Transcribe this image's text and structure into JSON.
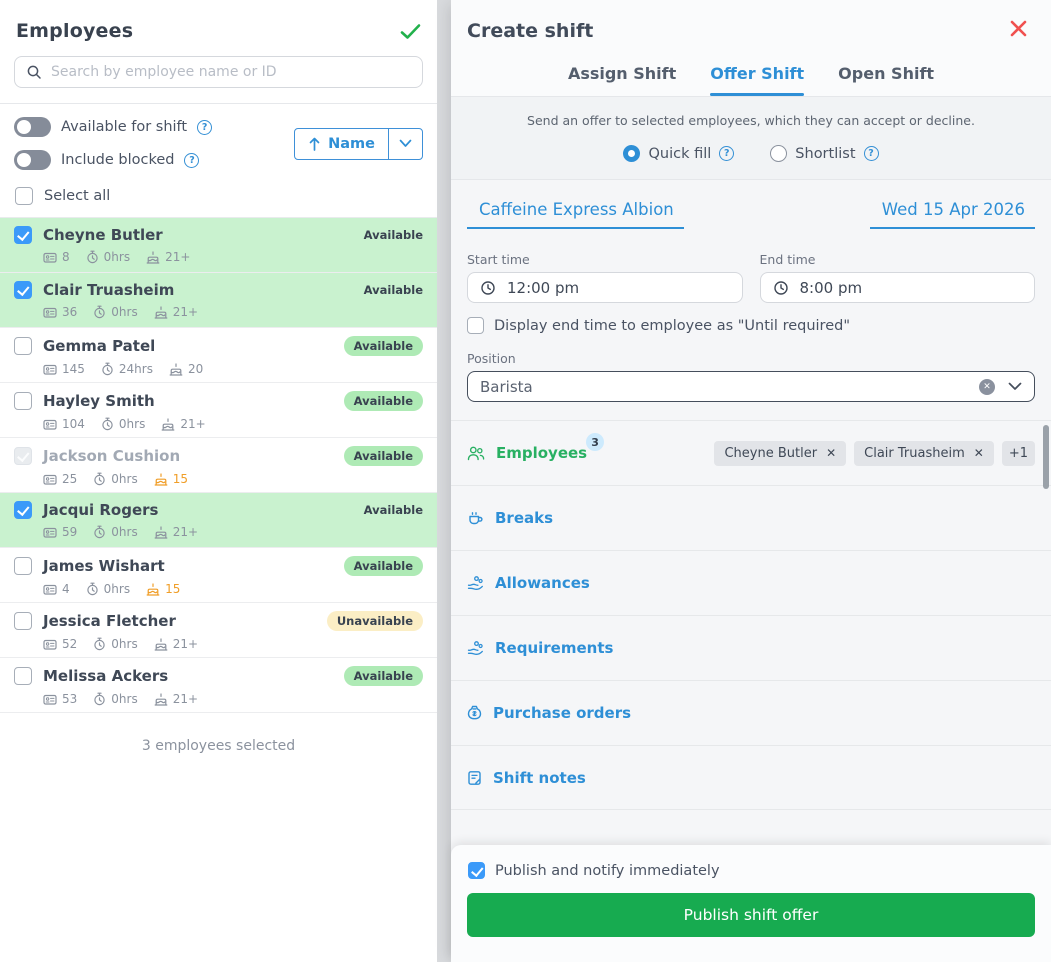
{
  "left_panel": {
    "title": "Employees",
    "search_placeholder": "Search by employee name or ID",
    "filters": {
      "available_for_shift": "Available for shift",
      "include_blocked": "Include blocked"
    },
    "sort": {
      "label": "Name"
    },
    "select_all_label": "Select all",
    "employees": [
      {
        "name": "Cheyne Butler",
        "status": "Available",
        "shifts": "8",
        "hours": "0hrs",
        "age": "21+",
        "selected": true,
        "disabled": false,
        "age_warning": false
      },
      {
        "name": "Clair Truasheim",
        "status": "Available",
        "shifts": "36",
        "hours": "0hrs",
        "age": "21+",
        "selected": true,
        "disabled": false,
        "age_warning": false
      },
      {
        "name": "Gemma Patel",
        "status": "Available",
        "shifts": "145",
        "hours": "24hrs",
        "age": "20",
        "selected": false,
        "disabled": false,
        "age_warning": false
      },
      {
        "name": "Hayley Smith",
        "status": "Available",
        "shifts": "104",
        "hours": "0hrs",
        "age": "21+",
        "selected": false,
        "disabled": false,
        "age_warning": false
      },
      {
        "name": "Jackson Cushion",
        "status": "Available",
        "shifts": "25",
        "hours": "0hrs",
        "age": "15",
        "selected": false,
        "disabled": true,
        "age_warning": true
      },
      {
        "name": "Jacqui Rogers",
        "status": "Available",
        "shifts": "59",
        "hours": "0hrs",
        "age": "21+",
        "selected": true,
        "disabled": false,
        "age_warning": false
      },
      {
        "name": "James Wishart",
        "status": "Available",
        "shifts": "4",
        "hours": "0hrs",
        "age": "15",
        "selected": false,
        "disabled": false,
        "age_warning": true
      },
      {
        "name": "Jessica Fletcher",
        "status": "Unavailable",
        "shifts": "52",
        "hours": "0hrs",
        "age": "21+",
        "selected": false,
        "disabled": false,
        "age_warning": false
      },
      {
        "name": "Melissa Ackers",
        "status": "Available",
        "shifts": "53",
        "hours": "0hrs",
        "age": "21+",
        "selected": false,
        "disabled": false,
        "age_warning": false
      }
    ],
    "selection_summary": "3 employees selected"
  },
  "dialog": {
    "title": "Create shift",
    "tabs": [
      {
        "label": "Assign Shift",
        "active": false
      },
      {
        "label": "Offer Shift",
        "active": true
      },
      {
        "label": "Open Shift",
        "active": false
      }
    ],
    "offer_description": "Send an offer to selected employees, which they can accept or decline.",
    "fill_modes": [
      {
        "label": "Quick fill",
        "selected": true
      },
      {
        "label": "Shortlist",
        "selected": false
      }
    ],
    "location": "Caffeine Express Albion",
    "date": "Wed 15 Apr 2026",
    "start_time": {
      "label": "Start time",
      "value": "12:00 pm"
    },
    "end_time": {
      "label": "End time",
      "value": "8:00 pm"
    },
    "until_required_label": "Display end time to employee as \"Until required\"",
    "position": {
      "label": "Position",
      "value": "Barista"
    },
    "employees_section": {
      "label": "Employees",
      "count": "3",
      "chips": [
        "Cheyne Butler",
        "Clair Truasheim"
      ],
      "more_chip": "+1"
    },
    "sections": [
      "Breaks",
      "Allowances",
      "Requirements",
      "Purchase orders",
      "Shift notes"
    ],
    "footer": {
      "publish_label": "Publish and notify immediately",
      "submit_label": "Publish shift offer"
    }
  },
  "colors": {
    "accent_blue": "#2e8fd6",
    "checkbox_blue": "#3b9af9",
    "button_green": "#17ab50",
    "text_green": "#28b062",
    "selected_row_green": "#c9f2cf",
    "available_pill": "#aeeab5",
    "unavailable_pill": "#fbeec5",
    "warning_orange": "#f09e28",
    "close_red": "#f0504f"
  }
}
